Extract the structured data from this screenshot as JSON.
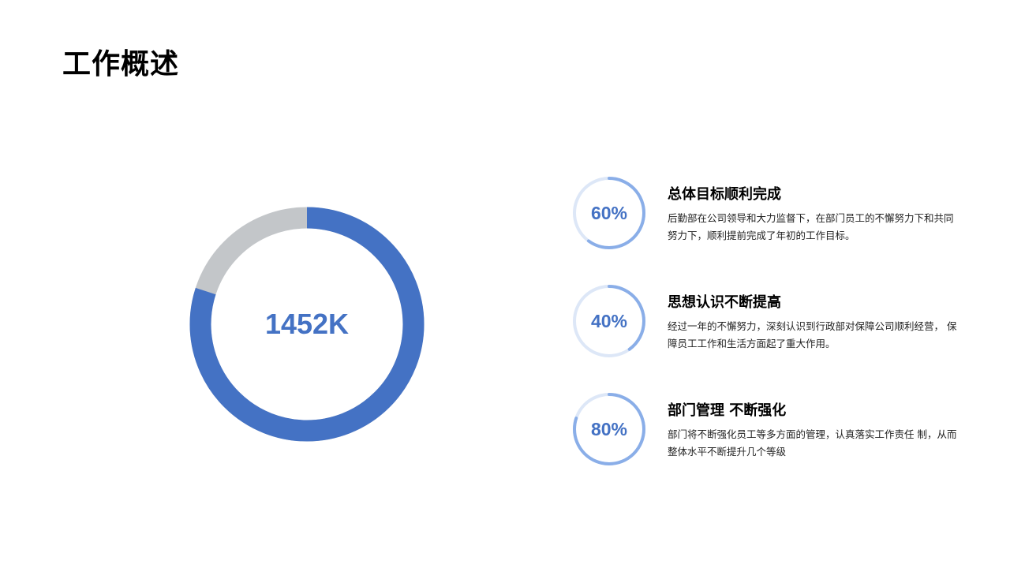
{
  "page": {
    "title": "工作概述"
  },
  "donut": {
    "label": "1452K",
    "fraction": 0.8,
    "primary_color": "#4472c4",
    "rest_color": "#c3c6c9"
  },
  "items": [
    {
      "percent_label": "60%",
      "percent": 60,
      "title": "总体目标顺利完成",
      "description": "后勤部在公司领导和大力监督下，在部门员工的不懈努力下和共同 努力下，顺利提前完成了年初的工作目标。"
    },
    {
      "percent_label": "40%",
      "percent": 40,
      "title": "思想认识不断提高",
      "description": "经过一年的不懈努力，深刻认识到行政部对保障公司顺利经营， 保障员工工作和生活方面起了重大作用。"
    },
    {
      "percent_label": "80%",
      "percent": 80,
      "title": "部门管理 不断强化",
      "description": "部门将不断强化员工等多方面的管理，认真落实工作责任 制，从而整体水平不断提升几个等级"
    }
  ],
  "colors": {
    "accent": "#4472c4",
    "ring_progress": "#8aaee8",
    "ring_track": "#dde7f7"
  }
}
